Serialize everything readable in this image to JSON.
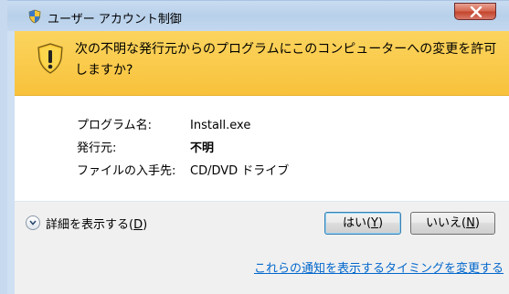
{
  "window": {
    "title": "ユーザー アカウント制御",
    "close_label": "x"
  },
  "warning": {
    "message": "次の不明な発行元からのプログラムにこのコンピューターへの変更を許可しますか?"
  },
  "details": {
    "program_label": "プログラム名:",
    "program_value": "Install.exe",
    "publisher_label": "発行元:",
    "publisher_value": "不明",
    "origin_label": "ファイルの入手先:",
    "origin_value": "CD/DVD ドライブ"
  },
  "footer": {
    "show_details_prefix": "詳細を表示する(",
    "show_details_key": "D",
    "show_details_suffix": ")",
    "yes_prefix": "はい(",
    "yes_key": "Y",
    "yes_suffix": ")",
    "no_prefix": "いいえ(",
    "no_key": "N",
    "no_suffix": ")",
    "notification_link": "これらの通知を表示するタイミングを変更する"
  },
  "colors": {
    "warning_band": "#f8c23b",
    "link": "#0066cc",
    "close_button": "#c3462d"
  },
  "icons": {
    "title": "uac-shield-icon",
    "warning": "warning-shield-icon",
    "close": "close-icon",
    "expand": "chevron-down-icon"
  }
}
